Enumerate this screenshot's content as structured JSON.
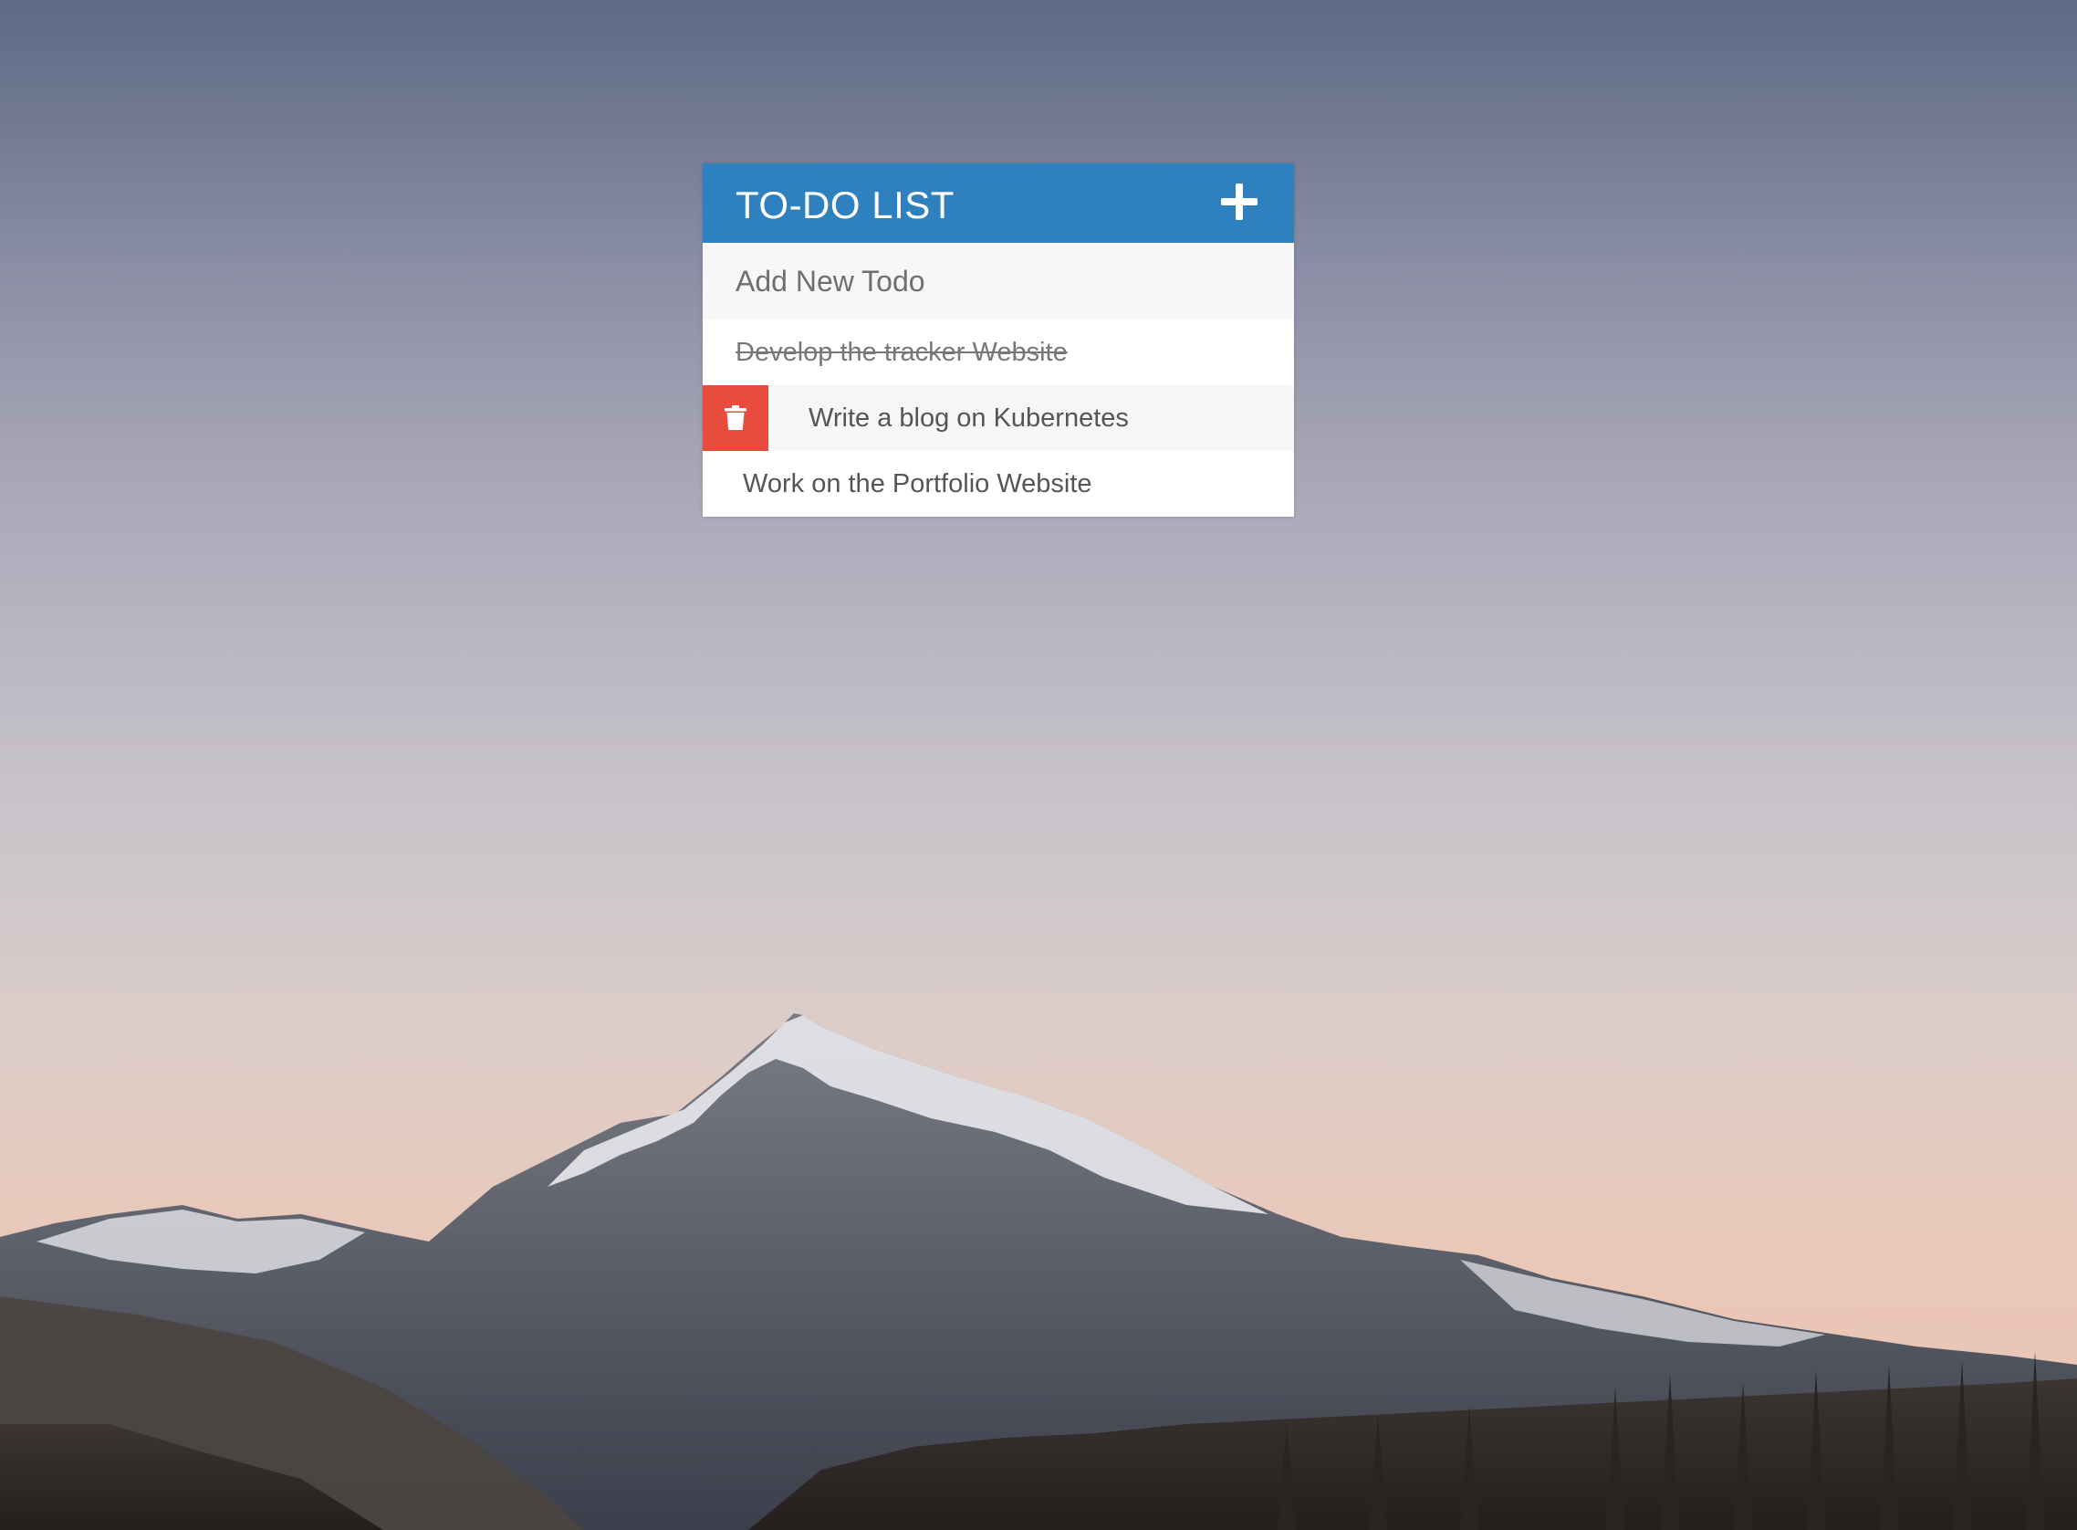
{
  "app": {
    "title": "TO-DO LIST"
  },
  "new_todo": {
    "placeholder": "Add New Todo"
  },
  "todos": [
    {
      "text": "Develop the tracker Website",
      "completed": true
    },
    {
      "text": "Write a blog on Kubernetes",
      "completed": false,
      "hovered": true
    },
    {
      "text": "Work on the Portfolio Website",
      "completed": false
    }
  ],
  "icons": {
    "add": "plus-icon",
    "delete": "trash-icon"
  },
  "colors": {
    "header": "#2e80be",
    "delete": "#e74c3c"
  }
}
